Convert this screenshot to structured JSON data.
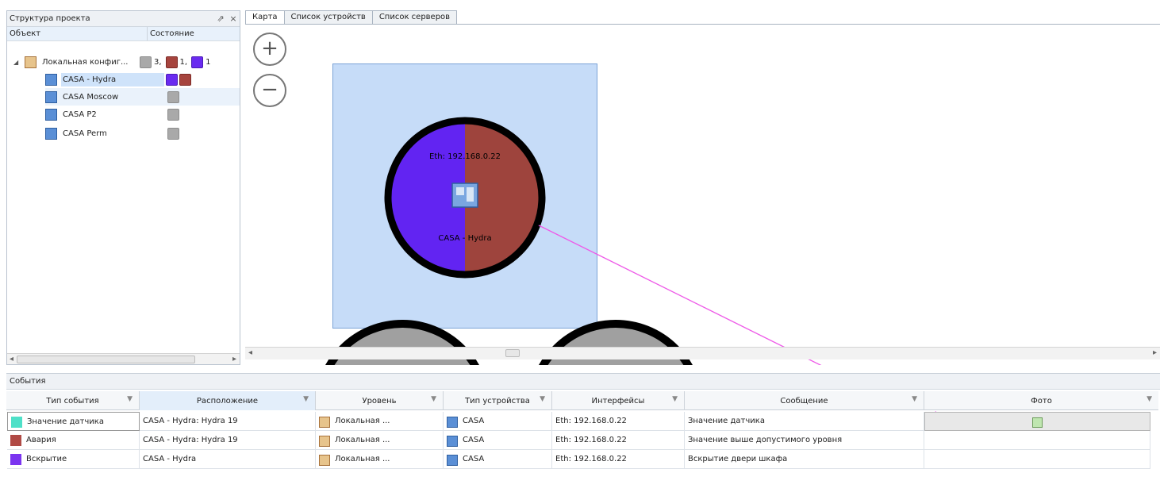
{
  "project_panel": {
    "title": "Структура проекта",
    "pin_icon": "pin-icon",
    "close_label": "×",
    "columns": [
      "Объект",
      "Состояние"
    ],
    "root": {
      "label": "Локальная конфиг...",
      "state": [
        {
          "color": "gray",
          "count": "3,"
        },
        {
          "color": "red",
          "count": "1,"
        },
        {
          "color": "purple",
          "count": "1"
        }
      ]
    },
    "devices": [
      {
        "label": "CASA - Hydra",
        "state": [
          "purple",
          "red"
        ],
        "selected": true
      },
      {
        "label": "CASA Moscow",
        "state": [
          "gray"
        ],
        "hover": true
      },
      {
        "label": "CASA P2",
        "state": [
          "gray"
        ]
      },
      {
        "label": "CASA Perm",
        "state": [
          "gray"
        ]
      }
    ]
  },
  "tabs": [
    {
      "label": "Карта",
      "active": true
    },
    {
      "label": "Список устройств",
      "active": false
    },
    {
      "label": "Список серверов",
      "active": false
    }
  ],
  "map": {
    "zoom_in": "+",
    "zoom_out": "−",
    "device": {
      "interface": "Eth: 192.168.0.22",
      "name": "CASA - Hydra"
    },
    "colors": {
      "left_half": "#6224f2",
      "right_half": "#9e443d",
      "selection": "#c6dcf8"
    }
  },
  "events": {
    "title": "События",
    "columns": [
      "Тип события",
      "Расположение",
      "Уровень",
      "Тип устройства",
      "Интерфейсы",
      "Сообщение",
      "Фото"
    ],
    "rows": [
      {
        "type": "Значение датчика",
        "color": "#4ee0c8",
        "location": "CASA - Hydra: Hydra 19",
        "level": "Локальная ...",
        "device_type": "CASA",
        "iface": "Eth: 192.168.0.22",
        "message": "Значение датчика",
        "photo": true
      },
      {
        "type": "Авария",
        "color": "#b04a45",
        "location": "CASA - Hydra: Hydra 19",
        "level": "Локальная ...",
        "device_type": "CASA",
        "iface": "Eth: 192.168.0.22",
        "message": "Значение выше допустимого уровня",
        "photo": false
      },
      {
        "type": "Вскрытие",
        "color": "#7b34f0",
        "location": "CASA - Hydra",
        "level": "Локальная ...",
        "device_type": "CASA",
        "iface": "Eth: 192.168.0.22",
        "message": "Вскрытие двери шкафа",
        "photo": false
      }
    ]
  }
}
